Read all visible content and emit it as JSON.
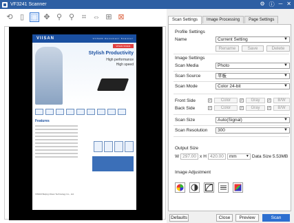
{
  "window": {
    "title": "VF3241 Scanner",
    "controls": [
      "⚙",
      "ⓘ",
      "─",
      "✕"
    ]
  },
  "toolbar": {
    "tools": [
      "rotate-left",
      "page",
      "select",
      "pan",
      "zoom-in",
      "zoom-out",
      "crop",
      "fit-width",
      "fit-page",
      "delete"
    ]
  },
  "preview": {
    "brand": "VIISAN",
    "brand_sub": "VIISAN Document Scanner",
    "model_tag": "VIISAN VF3241",
    "tag1": "Stylish Productivity",
    "tag2": "High performance",
    "tag3": "High speed",
    "features_title": "Features",
    "footer": "VIISAN   Beijing Viisan Technology Co., Ltd."
  },
  "tabs": [
    {
      "label": "Scan Settings",
      "active": true
    },
    {
      "label": "Image Processing",
      "active": false
    },
    {
      "label": "Page Settings",
      "active": false
    }
  ],
  "profile": {
    "section": "Profile Settings",
    "name_label": "Name",
    "name_value": "Current Setting",
    "rename": "Rename",
    "save": "Save",
    "delete": "Delete"
  },
  "image_settings": {
    "section": "Image Settings",
    "scan_media_label": "Scan Media",
    "scan_media_value": "Photo",
    "scan_source_label": "Scan Source",
    "scan_source_value": "平板",
    "scan_mode_label": "Scan Mode",
    "scan_mode_value": "Color 24-bit",
    "front_side_label": "Front Side",
    "back_side_label": "Back Side",
    "color": "Color",
    "gray": "Gray",
    "bw": "B/W",
    "scan_size_label": "Scan Size",
    "scan_size_value": "Auto(Signal)",
    "resolution_label": "Scan Resolution",
    "resolution_value": "300"
  },
  "output_size": {
    "section": "Output Size",
    "w_label": "W",
    "w_value": "297.00",
    "x": "x",
    "h_label": "H",
    "h_value": "420.00",
    "unit": "mm",
    "data_size": "Data Size 5.53MB"
  },
  "image_adjustment": {
    "section": "Image Adjustment"
  },
  "buttons": {
    "defaults": "Defaults",
    "close": "Close",
    "preview": "Preview",
    "scan": "Scan"
  }
}
